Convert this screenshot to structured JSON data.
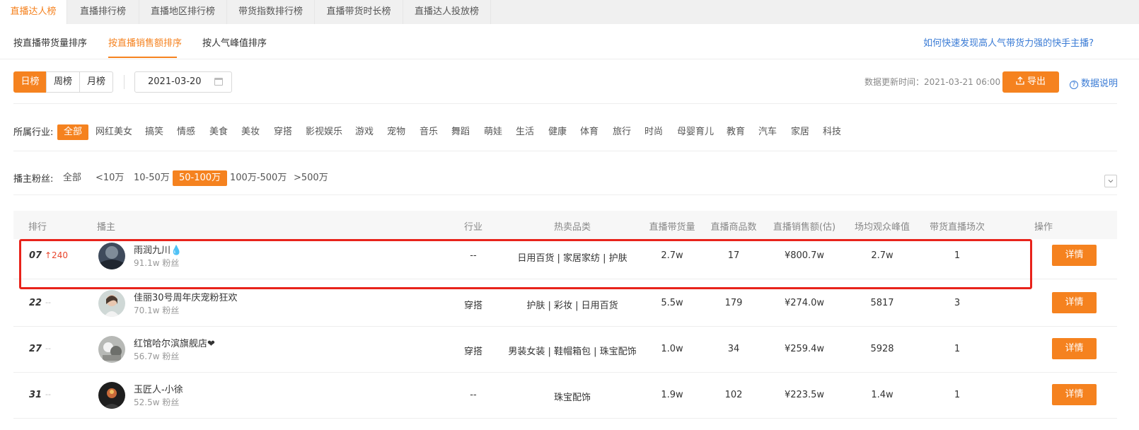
{
  "top_tabs": [
    "直播达人榜",
    "直播排行榜",
    "直播地区排行榜",
    "带货指数排行榜",
    "直播带货时长榜",
    "直播达人投放榜"
  ],
  "sub_tabs": [
    "按直播带货量排序",
    "按直播销售额排序",
    "按人气峰值排序"
  ],
  "help_link": "如何快速发现高人气带货力强的快手主播?",
  "period_tabs": [
    "日榜",
    "周榜",
    "月榜"
  ],
  "date_value": "2021-03-20",
  "update_time": "数据更新时间：2021-03-21 06:00",
  "export_label": "导出",
  "data_note_label": "数据说明",
  "industry": {
    "label": "所属行业:",
    "options": [
      "全部",
      "网红美女",
      "搞笑",
      "情感",
      "美食",
      "美妆",
      "穿搭",
      "影视娱乐",
      "游戏",
      "宠物",
      "音乐",
      "舞蹈",
      "萌娃",
      "生活",
      "健康",
      "体育",
      "旅行",
      "时尚",
      "母婴育儿",
      "教育",
      "汽车",
      "家居",
      "科技"
    ],
    "selected": "全部"
  },
  "fans": {
    "label": "播主粉丝:",
    "options": [
      "全部",
      "<10万",
      "10-50万",
      "50-100万",
      "100万-500万",
      ">500万"
    ],
    "selected": "50-100万"
  },
  "table": {
    "headers": [
      "排行",
      "播主",
      "行业",
      "热卖品类",
      "直播带货量",
      "直播商品数",
      "直播销售额(估)",
      "场均观众峰值",
      "带货直播场次",
      "操作"
    ],
    "rows": [
      {
        "rank": "07",
        "trend": "↑240",
        "name": "雨润九川💧",
        "fans": "91.1w 粉丝",
        "industry": "--",
        "categories": "日用百货 | 家居家纺 | 护肤",
        "volume": "2.7w",
        "products": "17",
        "sales": "¥800.7w",
        "peak": "2.7w",
        "sessions": "1",
        "action": "详情"
      },
      {
        "rank": "22",
        "trend": "--",
        "name": "佳丽30号周年庆宠粉狂欢",
        "fans": "70.1w 粉丝",
        "industry": "穿搭",
        "categories": "护肤 | 彩妆 | 日用百货",
        "volume": "5.5w",
        "products": "179",
        "sales": "¥274.0w",
        "peak": "5817",
        "sessions": "3",
        "action": "详情"
      },
      {
        "rank": "27",
        "trend": "--",
        "name": "红馆哈尔滨旗舰店❤",
        "fans": "56.7w 粉丝",
        "industry": "穿搭",
        "categories": "男装女装 | 鞋帽箱包 | 珠宝配饰",
        "volume": "1.0w",
        "products": "34",
        "sales": "¥259.4w",
        "peak": "5928",
        "sessions": "1",
        "action": "详情"
      },
      {
        "rank": "31",
        "trend": "--",
        "name": "玉匠人-小徐",
        "fans": "52.5w 粉丝",
        "industry": "--",
        "categories": "珠宝配饰",
        "volume": "1.9w",
        "products": "102",
        "sales": "¥223.5w",
        "peak": "1.4w",
        "sessions": "1",
        "action": "详情"
      }
    ]
  },
  "colors": {
    "accent": "#f5821f",
    "link": "#3a7bd5",
    "up": "#e8452c",
    "highlight": "#e8231b"
  }
}
